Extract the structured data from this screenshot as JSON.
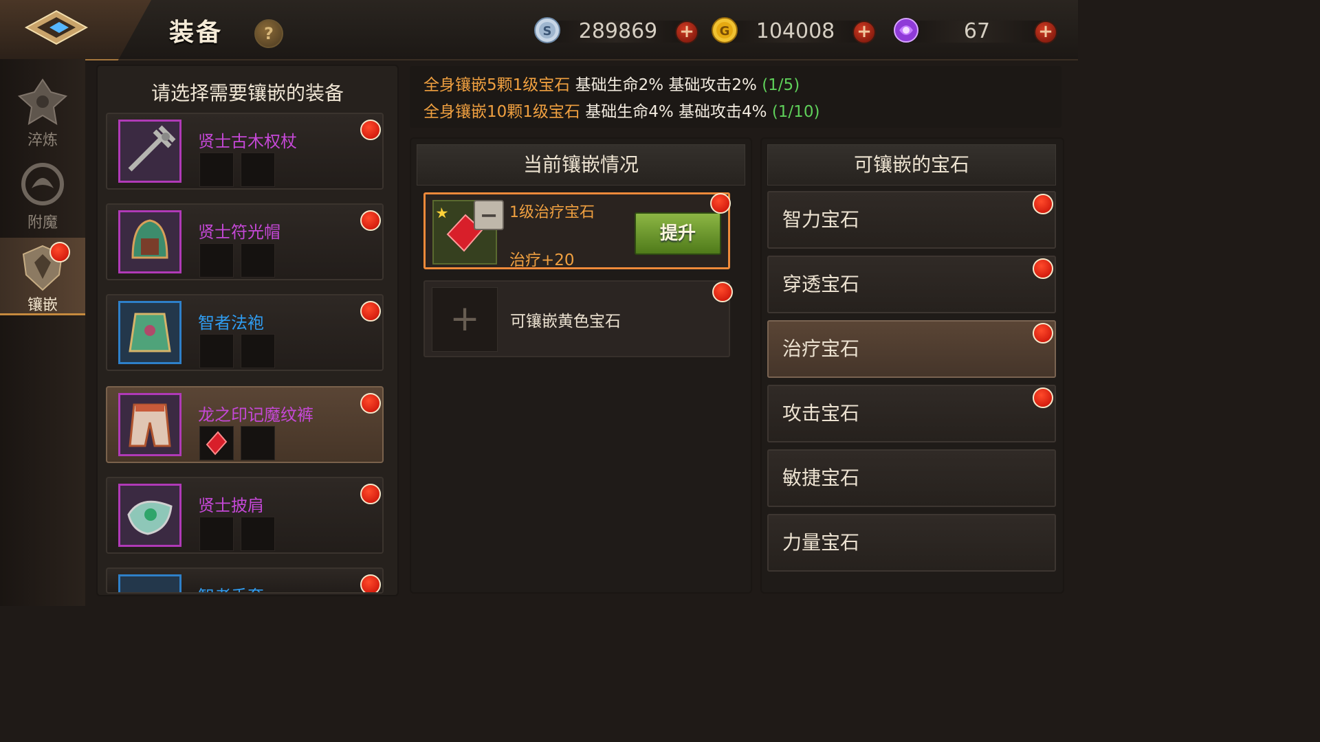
{
  "header": {
    "title": "装备",
    "help": "?",
    "currencies": [
      {
        "name": "silver",
        "icon": "silver-coin-icon",
        "value": "289869"
      },
      {
        "name": "gold",
        "icon": "gold-coin-icon",
        "value": "104008"
      },
      {
        "name": "gem",
        "icon": "purple-gem-icon",
        "value": "67"
      }
    ],
    "plus_symbol": "+"
  },
  "sidebar": {
    "items": [
      {
        "label": "淬炼",
        "active": false
      },
      {
        "label": "附魔",
        "active": false
      },
      {
        "label": "镶嵌",
        "active": true
      }
    ]
  },
  "equipment": {
    "title": "请选择需要镶嵌的装备",
    "items": [
      {
        "name": "贤士古木权杖",
        "quality": "purple"
      },
      {
        "name": "贤士符光帽",
        "quality": "purple"
      },
      {
        "name": "智者法袍",
        "quality": "blue"
      },
      {
        "name": "龙之印记魔纹裤",
        "quality": "purple",
        "selected": true
      },
      {
        "name": "贤士披肩",
        "quality": "purple"
      },
      {
        "name": "智者手套",
        "quality": "blue"
      }
    ]
  },
  "bonus": {
    "lines": [
      {
        "condition": "全身镶嵌5颗1级宝石",
        "effect": "基础生命2% 基础攻击2%",
        "progress": "(1/5)"
      },
      {
        "condition": "全身镶嵌10颗1级宝石",
        "effect": "基础生命4% 基础攻击4%",
        "progress": "(1/10)"
      }
    ]
  },
  "current": {
    "header": "当前镶嵌情况",
    "gem": {
      "name": "1级治疗宝石",
      "stat": "治疗+20",
      "upgrade_label": "提升",
      "remove_label": "−"
    },
    "empty_slot": {
      "label": "可镶嵌黄色宝石",
      "plus": "+"
    }
  },
  "available": {
    "header": "可镶嵌的宝石",
    "items": [
      {
        "label": "智力宝石",
        "dot": true
      },
      {
        "label": "穿透宝石",
        "dot": true
      },
      {
        "label": "治疗宝石",
        "dot": true,
        "selected": true
      },
      {
        "label": "攻击宝石",
        "dot": true
      },
      {
        "label": "敏捷宝石",
        "dot": false
      },
      {
        "label": "力量宝石",
        "dot": false
      }
    ]
  },
  "colors": {
    "accent_orange": "#f0a040",
    "progress_green": "#5fd05a",
    "purple_quality": "#c548d7",
    "blue_quality": "#2f9cf0"
  }
}
